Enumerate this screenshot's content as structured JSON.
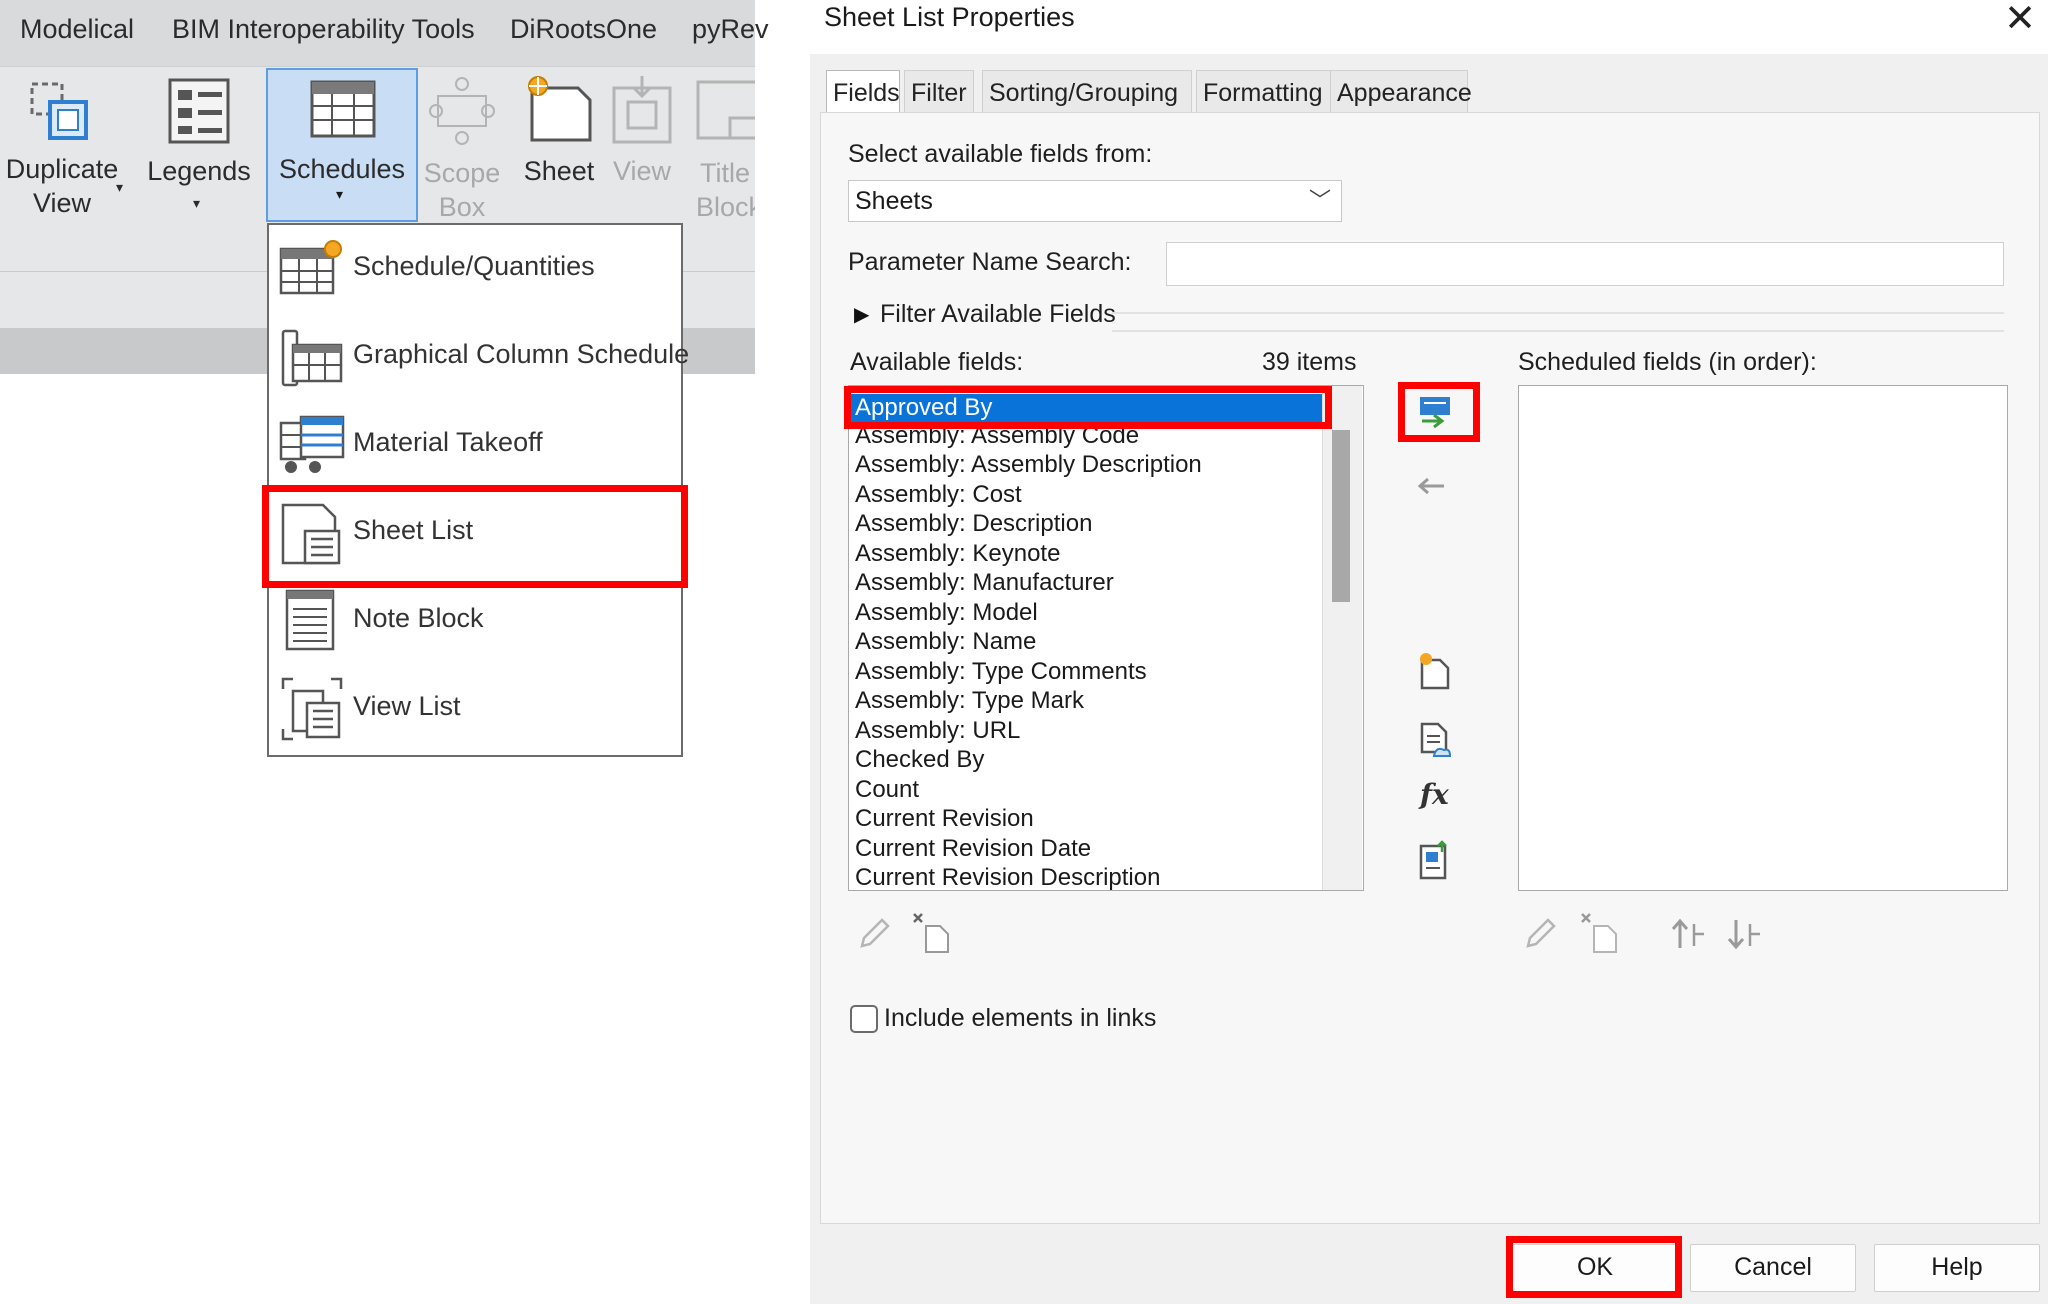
{
  "ribbon": {
    "tabs": [
      "Modelical",
      "BIM Interoperability Tools",
      "DiRootsOne",
      "pyRev"
    ],
    "buttons": {
      "duplicate_view": [
        "Duplicate",
        "View"
      ],
      "legends": "Legends",
      "schedules": "Schedules",
      "scope_box": [
        "Scope",
        "Box"
      ],
      "sheet": "Sheet",
      "view": "View",
      "title_block": [
        "Title",
        "Block"
      ]
    }
  },
  "schedules_menu": {
    "items": [
      "Schedule/Quantities",
      "Graphical Column Schedule",
      "Material Takeoff",
      "Sheet List",
      "Note Block",
      "View List"
    ]
  },
  "dialog": {
    "title": "Sheet List Properties",
    "close": "✕",
    "tabs": [
      "Fields",
      "Filter",
      "Sorting/Grouping",
      "Formatting",
      "Appearance"
    ],
    "select_from_label": "Select available fields from:",
    "select_from_value": "Sheets",
    "param_search_label": "Parameter Name Search:",
    "param_search_value": "",
    "filter_fields_label": "Filter Available Fields",
    "available_label": "Available fields:",
    "available_count": "39 items",
    "scheduled_label": "Scheduled fields (in order):",
    "available_fields": [
      "Approved By",
      "Assembly: Assembly Code",
      "Assembly: Assembly Description",
      "Assembly: Cost",
      "Assembly: Description",
      "Assembly: Keynote",
      "Assembly: Manufacturer",
      "Assembly: Model",
      "Assembly: Name",
      "Assembly: Type Comments",
      "Assembly: Type Mark",
      "Assembly: URL",
      "Checked By",
      "Count",
      "Current Revision",
      "Current Revision Date",
      "Current Revision Description"
    ],
    "selected_field": "Approved By",
    "include_links_label": "Include elements in links",
    "include_links_checked": false,
    "ok": "OK",
    "cancel": "Cancel",
    "help": "Help"
  },
  "colors": {
    "highlight": "#ff0000",
    "selection": "#0a73d9",
    "ribbon_active": "#c9def5"
  }
}
